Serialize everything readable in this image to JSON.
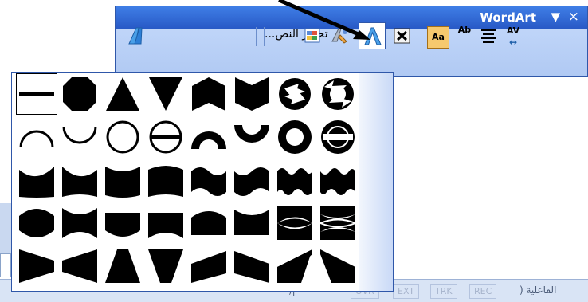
{
  "toolbar": {
    "title": "WordArt",
    "dropdown_glyph": "▼",
    "close_glyph": "×",
    "edit_text_label": "تحرير النص...",
    "icons": [
      "insert-wordart-icon",
      "edit-text-icon",
      "gallery-icon",
      "format-wordart-icon",
      "wordart-shape-icon",
      "text-wrapping-icon",
      "same-letter-heights-icon",
      "vertical-text-icon",
      "alignment-icon",
      "character-spacing-icon"
    ],
    "aa_label": "Aa",
    "ab_label": "Ab",
    "av_label": "AV"
  },
  "shape_palette": {
    "rows": 5,
    "columns": 8,
    "shapes": [
      [
        "plain-text",
        "stop",
        "triangle-up",
        "triangle-down",
        "chevron-up",
        "chevron-down",
        "ring-inside",
        "ring-outside"
      ],
      [
        "arch-up-curve",
        "arch-down-curve",
        "circle-curve",
        "button-curve",
        "arch-up-pour",
        "arch-down-pour",
        "circle-pour",
        "button-pour"
      ],
      [
        "curve-up",
        "curve-down",
        "can-up",
        "can-down",
        "wave1",
        "wave2",
        "double-wave1",
        "double-wave2"
      ],
      [
        "inflate",
        "deflate",
        "inflate-bottom",
        "deflate-bottom",
        "inflate-top",
        "deflate-top",
        "deflate-inflate",
        "deflate-inflate-deflate"
      ],
      [
        "fade-right",
        "fade-left",
        "fade-up",
        "fade-down",
        "slant-up",
        "slant-down",
        "cascade-up",
        "cascade-down"
      ]
    ]
  },
  "status_bar": {
    "segments": [
      "OVR",
      "EXT",
      "TRK",
      "REC"
    ],
    "right_text": "الفاعلية (",
    "left_text": "|("
  },
  "colors": {
    "titlebar": "#2859c6",
    "toolbar": "#b0c9f3",
    "accent_border": "#2f57a9"
  }
}
